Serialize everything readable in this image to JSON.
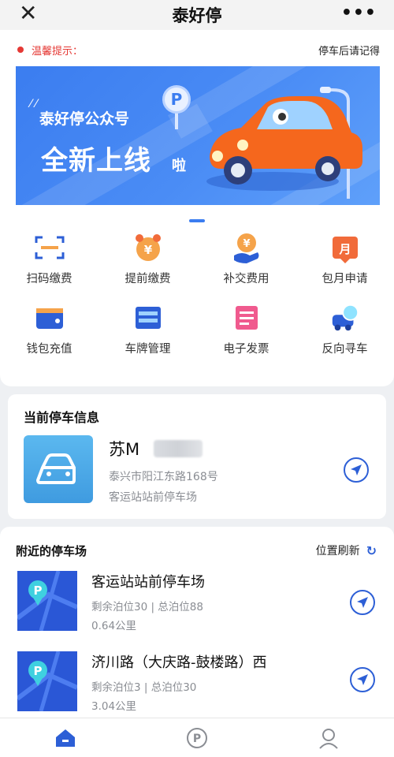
{
  "topbar": {
    "title": "泰好停",
    "close_icon": "close-icon",
    "more_icon": "more-icon"
  },
  "notice": {
    "label": "温馨提示：",
    "message": "停车后请记得"
  },
  "banner": {
    "subtitle": "泰好停公众号",
    "headline": "全新上线",
    "suffix": "啦",
    "parking_sign": "P"
  },
  "services": [
    {
      "label": "扫码缴费",
      "icon": "scan-icon"
    },
    {
      "label": "提前缴费",
      "icon": "alarm-clock-icon"
    },
    {
      "label": "补交费用",
      "icon": "coin-hand-icon"
    },
    {
      "label": "包月申请",
      "icon": "calendar-month-icon"
    },
    {
      "label": "钱包充值",
      "icon": "wallet-icon"
    },
    {
      "label": "车牌管理",
      "icon": "plate-icon"
    },
    {
      "label": "电子发票",
      "icon": "invoice-icon"
    },
    {
      "label": "反向寻车",
      "icon": "car-search-icon"
    }
  ],
  "current": {
    "heading": "当前停车信息",
    "plate": "苏M",
    "address": "泰兴市阳江东路168号",
    "lot": "客运站站前停车场"
  },
  "nearby": {
    "heading": "附近的停车场",
    "refresh_label": "位置刷新",
    "items": [
      {
        "name": "客运站站前停车场",
        "stats": "剩余泊位30 | 总泊位88",
        "distance": "0.64公里"
      },
      {
        "name": "济川路（大庆路-鼓楼路）西",
        "stats": "剩余泊位3 | 总泊位30",
        "distance": "3.04公里"
      }
    ]
  },
  "tabbar": {
    "items": [
      "home-icon",
      "parking-icon",
      "profile-icon"
    ]
  },
  "colors": {
    "primary": "#2d5fd6",
    "accent_red": "#e53935",
    "banner_blue": "#3b7df0"
  }
}
